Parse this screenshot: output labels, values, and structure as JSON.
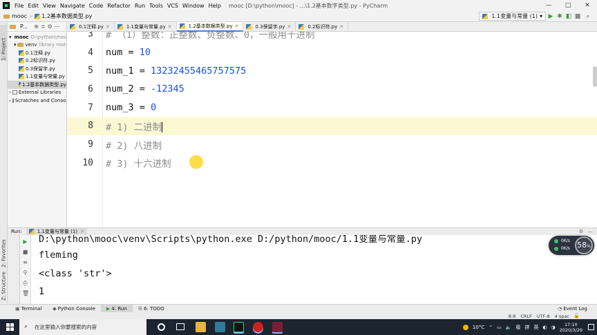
{
  "window": {
    "title": "mooc [D:\\python\\mooc] - ...\\1.2基本数字类型.py - PyCharm",
    "menu": [
      "File",
      "Edit",
      "View",
      "Navigate",
      "Code",
      "Refactor",
      "Run",
      "Tools",
      "VCS",
      "Window",
      "Help"
    ],
    "controls": {
      "minimize": "—",
      "maximize": "□",
      "close": "✕"
    }
  },
  "navbar": {
    "project": "mooc",
    "file": "1.2基本数据类型.py",
    "run_config": "1.1变量与常量 (1)"
  },
  "project_panel": {
    "header_label": "P...",
    "tree": [
      {
        "label": "mooc",
        "extra": "D:\\python\\mooc",
        "kind": "folder",
        "indent": 0
      },
      {
        "label": "venv",
        "extra": "library root",
        "kind": "folder",
        "indent": 1
      },
      {
        "label": "0.1注释.py",
        "extra": "",
        "kind": "py",
        "indent": 2
      },
      {
        "label": "0.2标识符.py",
        "extra": "",
        "kind": "py",
        "indent": 2
      },
      {
        "label": "0.3保留字.py",
        "extra": "",
        "kind": "py",
        "indent": 2
      },
      {
        "label": "1.1变量与常量.py",
        "extra": "",
        "kind": "py",
        "indent": 2
      },
      {
        "label": "1.2基本数据类型.py",
        "extra": "",
        "kind": "py",
        "indent": 2,
        "selected": true
      },
      {
        "label": "External Libraries",
        "extra": "",
        "kind": "lib",
        "indent": 0
      },
      {
        "label": "Scratches and Console",
        "extra": "",
        "kind": "lib",
        "indent": 0
      }
    ]
  },
  "left_stripe": {
    "project_tab": "1: Project",
    "favorites_tab": "2: Favorites",
    "structure_tab": "Z: Structure"
  },
  "tabs": [
    {
      "label": "0.1注释.py",
      "active": false
    },
    {
      "label": "1.1变量与常量.py",
      "active": false
    },
    {
      "label": "1.2基本数据类型.py",
      "active": true
    },
    {
      "label": "0.3保留字.py",
      "active": false
    },
    {
      "label": "0.2标识符.py",
      "active": false
    }
  ],
  "editor": {
    "lines": [
      {
        "n": "3",
        "tokens": [
          {
            "t": "# （1）整数：正整数、负整数、0，一般用十进制",
            "c": "cm"
          }
        ]
      },
      {
        "n": "4",
        "tokens": [
          {
            "t": "num",
            "c": "kw-var"
          },
          {
            "t": " = ",
            "c": "op"
          },
          {
            "t": "10",
            "c": "num"
          }
        ]
      },
      {
        "n": "5",
        "tokens": [
          {
            "t": "num_1",
            "c": "kw-var"
          },
          {
            "t": " = ",
            "c": "op"
          },
          {
            "t": "13232455465757575",
            "c": "num"
          }
        ]
      },
      {
        "n": "6",
        "tokens": [
          {
            "t": "num_2",
            "c": "kw-var"
          },
          {
            "t": " = ",
            "c": "op"
          },
          {
            "t": "-12345",
            "c": "num"
          }
        ]
      },
      {
        "n": "7",
        "tokens": [
          {
            "t": "num_3",
            "c": "kw-var"
          },
          {
            "t": " = ",
            "c": "op"
          },
          {
            "t": "0",
            "c": "num"
          }
        ]
      },
      {
        "n": "8",
        "tokens": [
          {
            "t": "# 1) 二进制",
            "c": "cm"
          }
        ],
        "current": true
      },
      {
        "n": "9",
        "tokens": [
          {
            "t": "# 2) 八进制",
            "c": "cm"
          }
        ]
      },
      {
        "n": "10",
        "tokens": [
          {
            "t": "# 3) 十六进制",
            "c": "cm"
          }
        ]
      }
    ]
  },
  "run_panel": {
    "label": "Run:",
    "tab": "1.1变量与常量 (1)",
    "output": [
      "D:\\python\\mooc\\venv\\Scripts\\python.exe D:/python/mooc/1.1变量与常量.py",
      "fleming",
      "<class 'str'>",
      "1"
    ]
  },
  "bottom_tools": [
    {
      "label": "Terminal",
      "active": false
    },
    {
      "label": "Python Console",
      "active": false
    },
    {
      "label": "4: Run",
      "active": true
    },
    {
      "label": "6: TODO",
      "active": false
    }
  ],
  "event_log": "Event Log",
  "status": {
    "position": "8:8",
    "line_sep": "CRLF",
    "encoding": "UTF-8",
    "indent": "4 spac"
  },
  "net_widget": {
    "percent": "58",
    "up": "0K/s",
    "down": "0K/s"
  },
  "taskbar": {
    "search_placeholder": "在这里输入你要搜索的内容",
    "temperature": "10°C",
    "ime": [
      "极",
      "拼",
      "英"
    ],
    "time": "17:10",
    "date": "2020/3/29"
  },
  "watermark": "工业磨方"
}
